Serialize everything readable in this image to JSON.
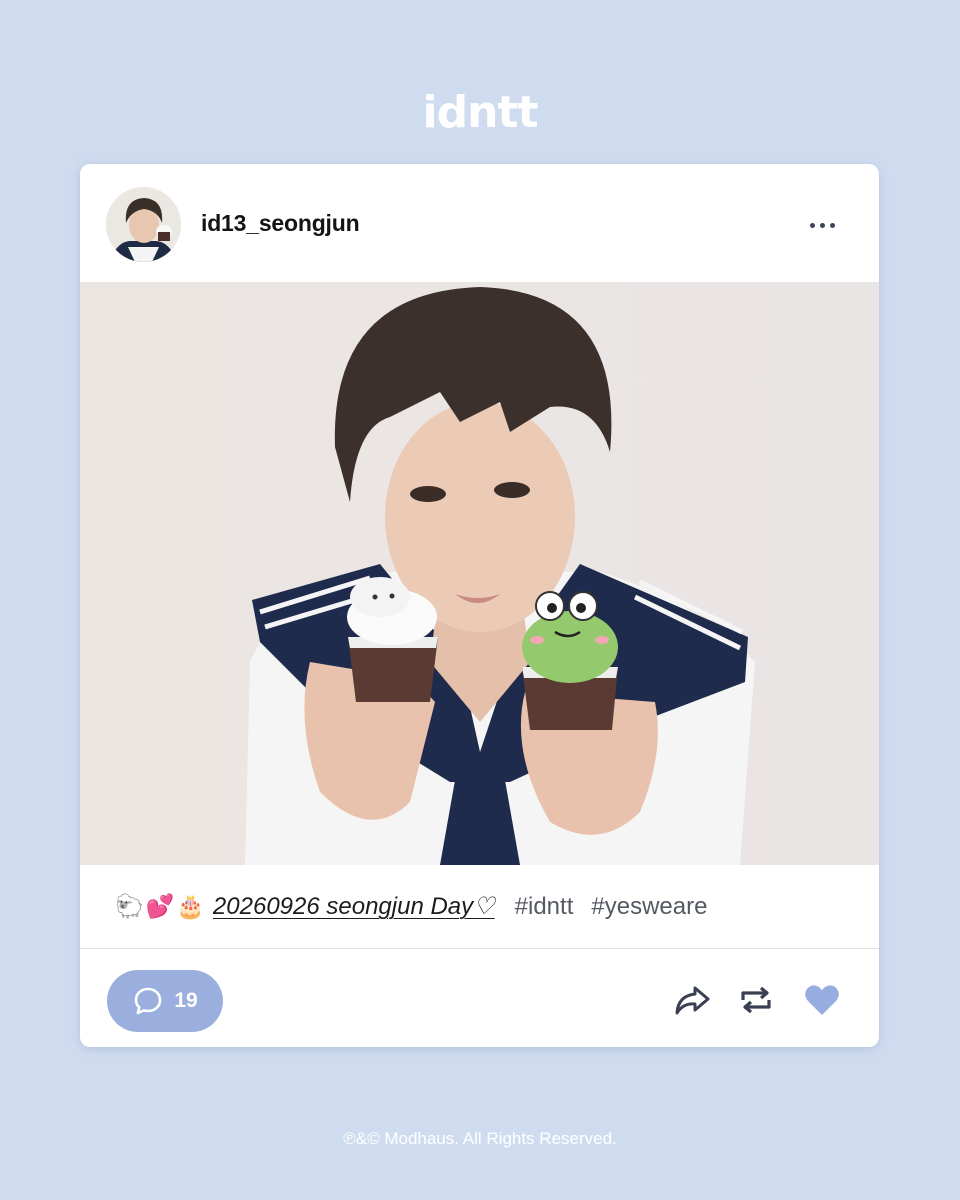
{
  "brand": {
    "logo_text": "idntt"
  },
  "post": {
    "username": "id13_seongjun",
    "more_icon": "more-horizontal-icon",
    "photo_description_icon": "photo",
    "caption": {
      "emojis": [
        "🐑",
        "💕",
        "🎂"
      ],
      "title": "20260926 seongjun Day♡",
      "hashtags": [
        "#idntt",
        "#yesweare"
      ]
    },
    "actions": {
      "comment_count": "19",
      "share_icon": "share-icon",
      "repost_icon": "repost-icon",
      "like_icon": "heart-icon"
    }
  },
  "colors": {
    "background": "#cfdcf0",
    "accent": "#9aafde",
    "text": "#141414"
  },
  "footer": {
    "copyright": "℗&© Modhaus. All Rights Reserved."
  }
}
